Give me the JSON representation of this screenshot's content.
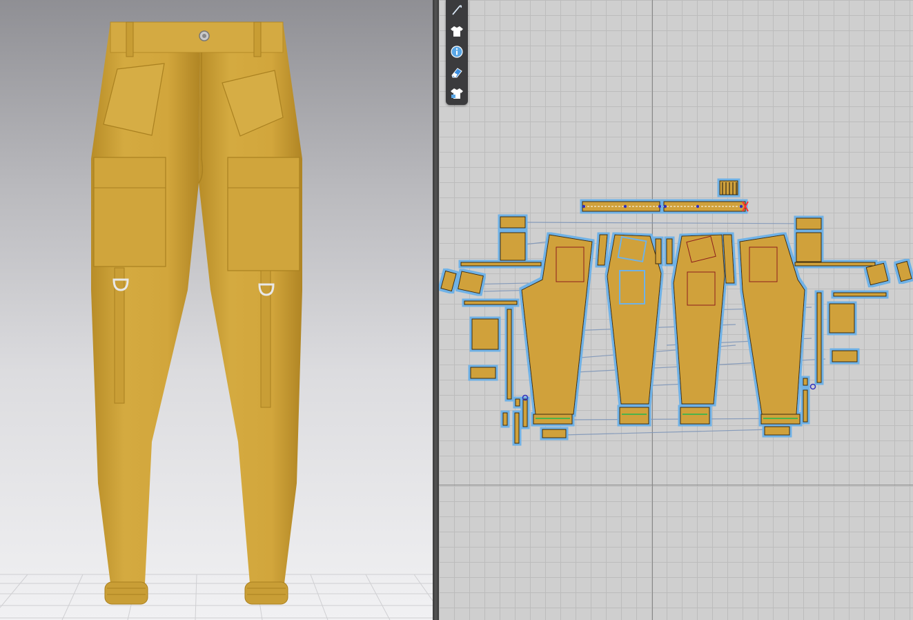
{
  "app": {
    "panels": [
      "3d-garment-view",
      "2d-pattern-view"
    ]
  },
  "toolbar_2d": {
    "tools": [
      {
        "icon": "needle-icon"
      },
      {
        "icon": "shirt-icon"
      },
      {
        "icon": "info-icon"
      },
      {
        "icon": "eraser-icon"
      },
      {
        "icon": "shirt-lock-icon"
      }
    ]
  },
  "colors": {
    "fabric": "#d2a63c",
    "fabric_shadow": "#b58a26",
    "pattern_fill": "#d0a13a",
    "pattern_outline": "#6fb2e6",
    "sewing_line": "#7f96b8",
    "selected_seam": "#ff3030",
    "grid_bg": "#cfcfcf",
    "viewport_bg_top": "#8f8f94",
    "viewport_bg_bottom": "#f1f1f3"
  }
}
